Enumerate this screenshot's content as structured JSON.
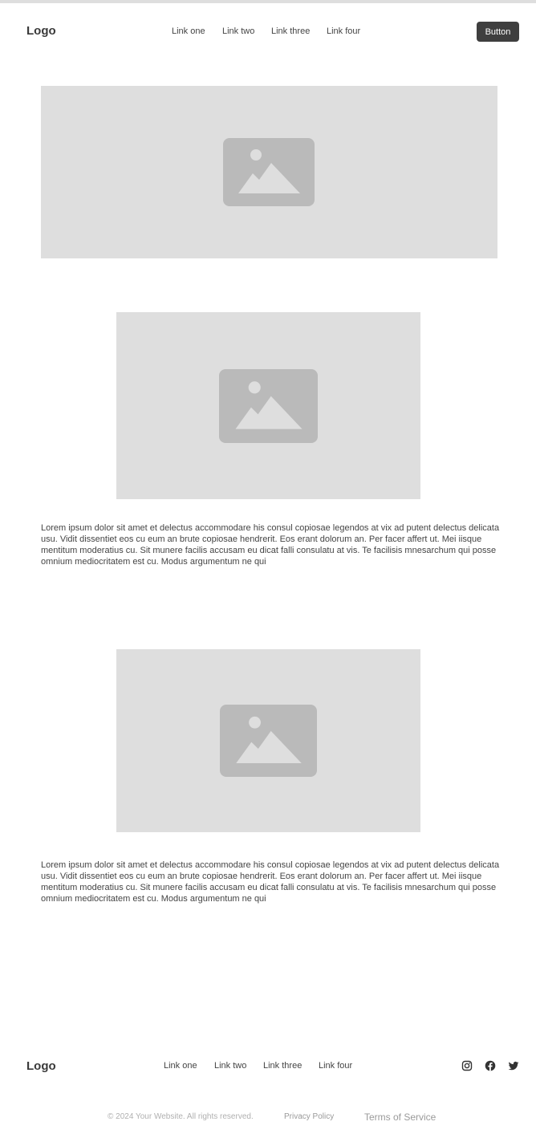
{
  "header": {
    "logo": "Logo",
    "nav": [
      "Link one",
      "Link two",
      "Link three",
      "Link four"
    ],
    "button_label": "Button"
  },
  "images": [
    "image-placeholder-icon",
    "image-placeholder-icon",
    "image-placeholder-icon"
  ],
  "sections": [
    {
      "text": "Lorem ipsum dolor sit amet et delectus accommodare his consul copiosae legendos at vix ad putent delectus delicata usu. Vidit dissentiet eos cu eum an brute copiosae hendrerit. Eos erant dolorum an. Per facer affert ut. Mei iisque mentitum moderatius cu. Sit munere facilis accusam eu dicat falli consulatu at vis. Te facilisis mnesarchum qui posse omnium mediocritatem est cu. Modus argumentum ne qui"
    },
    {
      "text": "Lorem ipsum dolor sit amet et delectus accommodare his consul copiosae legendos at vix ad putent delectus delicata usu. Vidit dissentiet eos cu eum an brute copiosae hendrerit. Eos erant dolorum an. Per facer affert ut. Mei iisque mentitum moderatius cu. Sit munere facilis accusam eu dicat falli consulatu at vis. Te facilisis mnesarchum qui posse omnium mediocritatem est cu. Modus argumentum ne qui"
    }
  ],
  "footer": {
    "logo": "Logo",
    "nav": [
      "Link one",
      "Link two",
      "Link three",
      "Link four"
    ],
    "social_icons": [
      "instagram-icon",
      "facebook-icon",
      "twitter-icon"
    ],
    "copyright": "© 2024 Your Website. All rights reserved.",
    "privacy": "Privacy Policy",
    "terms": "Terms of Service"
  },
  "colors": {
    "placeholder_bg": "#dedede",
    "placeholder_icon": "#bababa",
    "button_bg": "#3f3f3f"
  }
}
